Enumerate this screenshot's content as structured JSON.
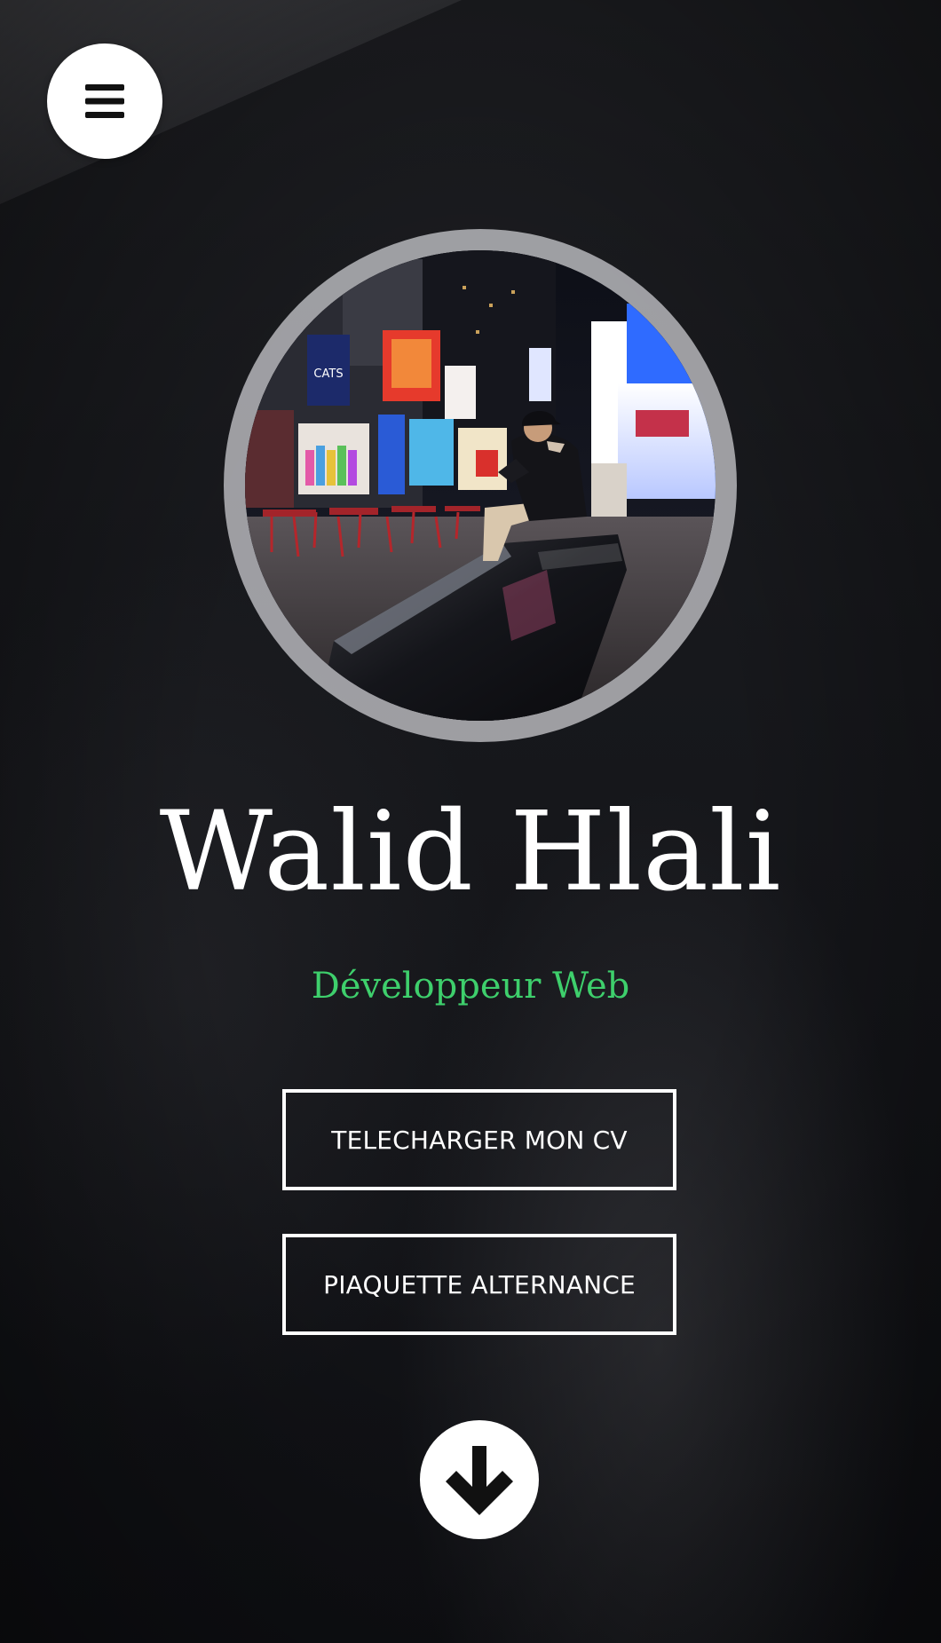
{
  "header": {
    "menu_icon": "hamburger-menu-icon"
  },
  "profile": {
    "name": "Walid Hlali",
    "role": "Développeur Web",
    "role_color": "#3ecf6c"
  },
  "actions": {
    "download_cv_label": "TELECHARGER MON CV",
    "alternance_label": "PIAQUETTE ALTERNANCE"
  },
  "scroll": {
    "icon": "arrow-down-icon"
  },
  "photo": {
    "billboard_text": "CATS"
  }
}
